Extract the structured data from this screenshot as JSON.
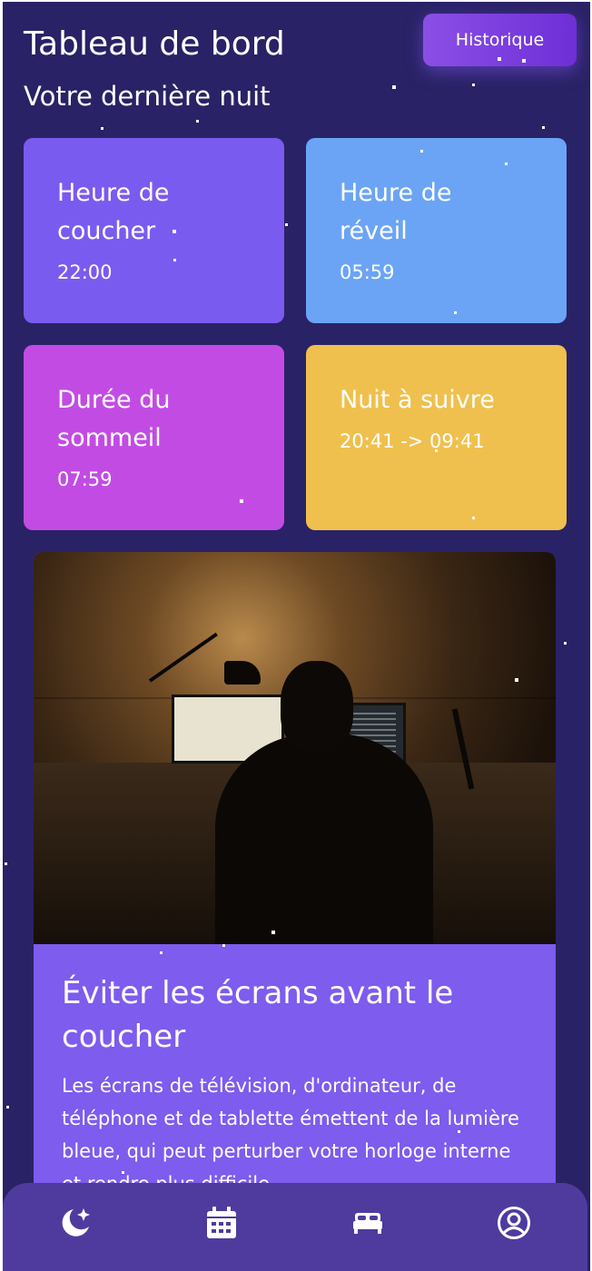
{
  "header": {
    "title": "Tableau de bord",
    "subtitle": "Votre dernière nuit",
    "history_button": "Historique"
  },
  "cards": [
    {
      "title": "Heure de coucher",
      "value": "22:00",
      "color": "#7a5bef"
    },
    {
      "title": "Heure de réveil",
      "value": "05:59",
      "color": "#6ba4f5"
    },
    {
      "title": "Durée du sommeil",
      "value": "07:59",
      "color": "#c24ce3"
    },
    {
      "title": "Nuit à suivre",
      "value": "20:41 -> 09:41",
      "color": "#f0c04e"
    }
  ],
  "tip": {
    "title": "Éviter les écrans avant le coucher",
    "body": "Les écrans de télévision, d'ordinateur, de téléphone et de tablette émettent de la lumière bleue, qui peut perturber votre horloge interne et rendre plus difficile"
  },
  "nav": {
    "items": [
      {
        "icon": "moon-star-icon"
      },
      {
        "icon": "calendar-icon"
      },
      {
        "icon": "bed-icon"
      },
      {
        "icon": "user-circle-icon"
      }
    ]
  },
  "colors": {
    "background": "#2a2266",
    "accent": "#7d5cee",
    "nav_background": "#4f3b9e"
  }
}
